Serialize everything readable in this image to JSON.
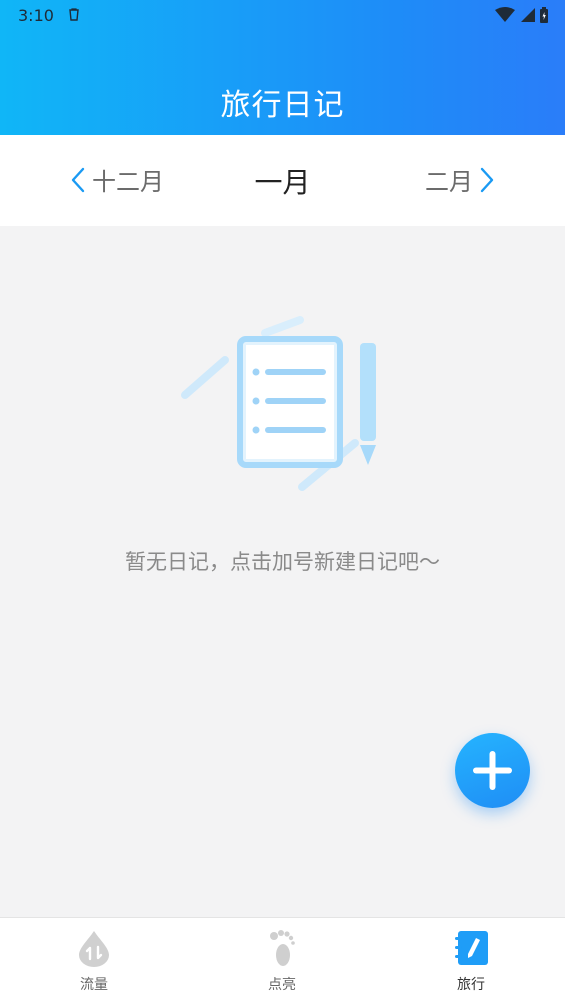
{
  "status_bar": {
    "time": "3:10",
    "icons": [
      "notification-icon",
      "wifi-icon",
      "signal-icon",
      "battery-icon"
    ]
  },
  "header": {
    "title": "旅行日记"
  },
  "month_nav": {
    "prev": "十二月",
    "current": "一月",
    "next": "二月"
  },
  "empty_state": {
    "message": "暂无日记，点击加号新建日记吧～",
    "icon": "notebook-pencil-icon"
  },
  "fab": {
    "icon": "plus-icon"
  },
  "tabs": [
    {
      "label": "流量",
      "icon": "data-drop-icon",
      "active": false
    },
    {
      "label": "点亮",
      "icon": "footprint-icon",
      "active": false
    },
    {
      "label": "旅行",
      "icon": "diary-icon",
      "active": true
    }
  ],
  "colors": {
    "header_start": "#10b6f7",
    "header_end": "#2a7df9",
    "accent": "#1f8df5",
    "background": "#f3f3f4"
  }
}
